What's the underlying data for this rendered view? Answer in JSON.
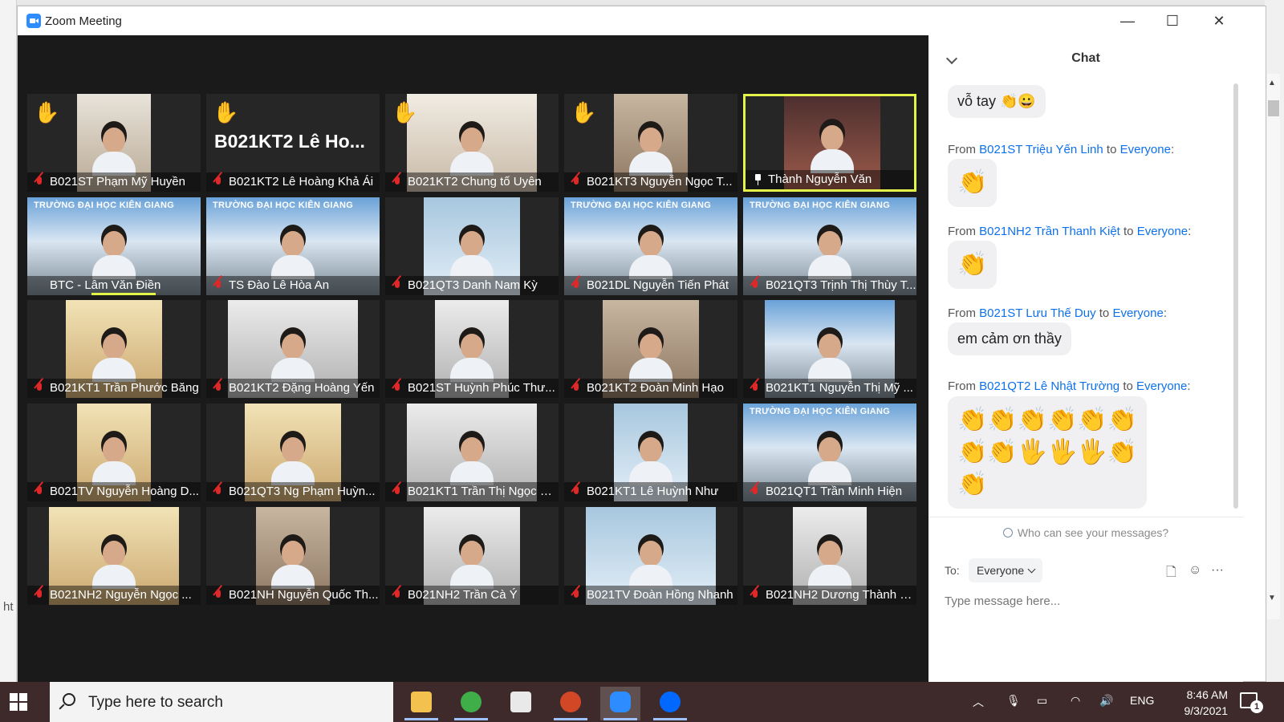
{
  "window": {
    "title": "Zoom Meeting"
  },
  "browser": {
    "url_fragment": "ht"
  },
  "hand_icon": "✋",
  "banner_text": "TRƯỜNG ĐẠI HỌC KIÊN GIANG",
  "tiles": [
    {
      "name": "B021ST Phạm Mỹ Huyền",
      "hand": true,
      "bg": "v-a",
      "muted": true
    },
    {
      "name": "B021KT2 Lê Hoàng Khả Ái",
      "hand": true,
      "bigname": "B021KT2 Lê Ho...",
      "bg": "none",
      "muted": true
    },
    {
      "name": "B021KT2 Chung tố Uyên",
      "hand": true,
      "bg": "v-c",
      "muted": true
    },
    {
      "name": "B021KT3 Nguyễn Ngọc T...",
      "hand": true,
      "bg": "v-d",
      "muted": true
    },
    {
      "name": "Thành Nguyễn Văn",
      "active": true,
      "bg": "v-h",
      "muted": false
    },
    {
      "name": "BTC - Lâm Văn Điền",
      "bg": "v-b",
      "banner": true,
      "muted": false,
      "speaking": true
    },
    {
      "name": "TS Đào Lê Hòa An",
      "bg": "v-b",
      "banner": true,
      "muted": true
    },
    {
      "name": "B021QT3 Danh Nam Kỳ",
      "bg": "v-e",
      "muted": true
    },
    {
      "name": "B021DL Nguyễn Tiến Phát",
      "bg": "v-b",
      "banner": true,
      "muted": true
    },
    {
      "name": "B021QT3 Trịnh Thị Thùy T...",
      "bg": "v-b",
      "banner": true,
      "muted": true
    },
    {
      "name": "B021KT1 Trần Phước Băng",
      "bg": "v-f",
      "muted": true
    },
    {
      "name": "B021KT2 Đặng Hoàng Yến",
      "bg": "v-g",
      "muted": true
    },
    {
      "name": "B021ST Huỳnh Phúc Thư...",
      "bg": "v-g",
      "muted": true
    },
    {
      "name": "B021KT2 Đoàn Minh Hạo",
      "bg": "v-d",
      "muted": true
    },
    {
      "name": "B021KT1 Nguyễn Thị Mỹ ...",
      "bg": "v-b",
      "muted": true
    },
    {
      "name": "B021TV Nguyễn Hoàng D...",
      "bg": "v-f",
      "muted": true
    },
    {
      "name": "B021QT3 Ng Phạm Huỳn...",
      "bg": "v-f",
      "muted": true
    },
    {
      "name": "B021KT1 Trần Thị Ngọc D...",
      "bg": "v-g",
      "muted": true
    },
    {
      "name": "B021KT1 Lê Huỳnh Như",
      "bg": "v-e",
      "muted": true
    },
    {
      "name": "B021QT1 Trần Minh Hiện",
      "bg": "v-b",
      "banner": true,
      "muted": true
    },
    {
      "name": "B021NH2  Nguyễn Ngọc ...",
      "bg": "v-f",
      "muted": true
    },
    {
      "name": "B021NH Nguyễn Quốc Th...",
      "bg": "v-d",
      "muted": true
    },
    {
      "name": "B021NH2 Trần Cà Ý",
      "bg": "v-g",
      "muted": true
    },
    {
      "name": "B021TV Đoàn Hồng Nhanh",
      "bg": "v-e",
      "muted": true
    },
    {
      "name": "B021NH2 Dương Thành V...",
      "bg": "v-g",
      "muted": true
    }
  ],
  "chat": {
    "title": "Chat",
    "first_message": "vỗ tay 👏😀",
    "messages": [
      {
        "prefix": "From",
        "sender": "B021ST Triệu Yến Linh",
        "mid": "to",
        "recipient": "Everyone",
        "suffix": ":",
        "content": "👏"
      },
      {
        "prefix": "From",
        "sender": "B021NH2 Trần Thanh Kiệt",
        "mid": "to",
        "recipient": "Everyone",
        "suffix": ":",
        "content": "👏"
      },
      {
        "prefix": "From",
        "sender": "B021ST Lưu Thế Duy",
        "mid": "to",
        "recipient": "Everyone",
        "suffix": ":",
        "content": "em cảm ơn thầy"
      },
      {
        "prefix": "From",
        "sender": "B021QT2 Lê Nhật Trường",
        "mid": "to",
        "recipient": "Everyone",
        "suffix": ":",
        "content": "👏👏👏👏👏👏\n👏👏🖐🖐🖐👏\n👏"
      }
    ],
    "who_can_see": "Who can see your messages?",
    "to_label": "To:",
    "to_value": "Everyone",
    "input_placeholder": "Type message here...",
    "more_icon": "···"
  },
  "taskbar": {
    "search_placeholder": "Type here to search",
    "language": "ENG",
    "time": "8:46 AM",
    "date": "9/3/2021",
    "notifications": "1",
    "apps": [
      "file-explorer",
      "browser",
      "store",
      "powerpoint",
      "zoom",
      "zalo"
    ]
  },
  "colors": {
    "accent": "#0e71eb",
    "active_border": "#e4f34a",
    "muted_red": "#e02828",
    "taskbar": "#3e2a2a"
  }
}
